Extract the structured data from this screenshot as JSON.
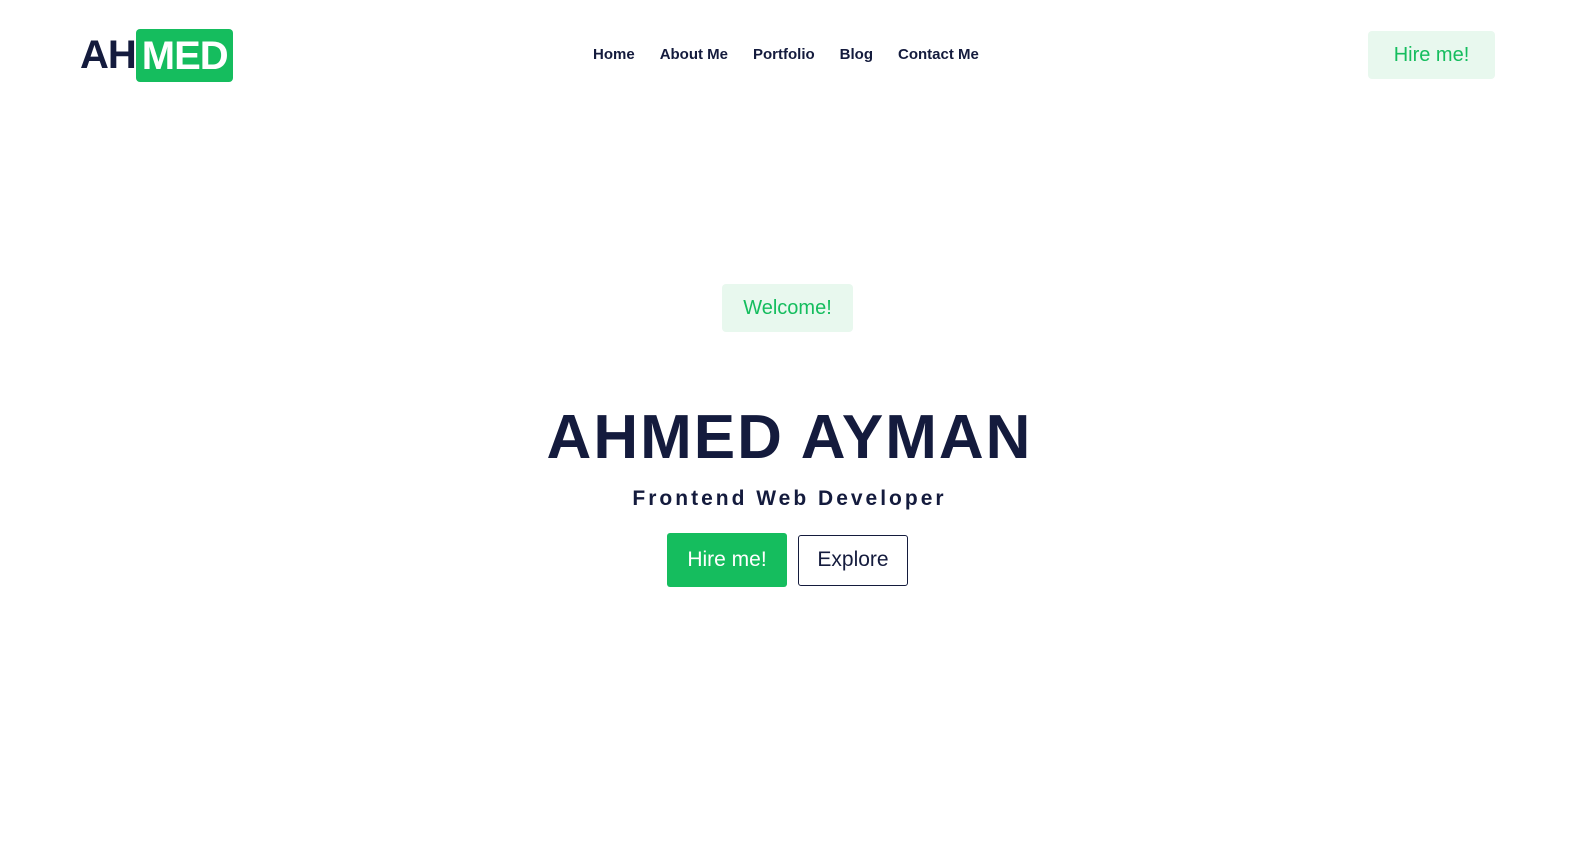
{
  "header": {
    "logo": {
      "part_a": "AH",
      "part_b": "MED"
    },
    "nav": [
      {
        "label": "Home"
      },
      {
        "label": "About Me"
      },
      {
        "label": "Portfolio"
      },
      {
        "label": "Blog"
      },
      {
        "label": "Contact Me"
      }
    ],
    "cta_label": "Hire me!"
  },
  "hero": {
    "badge": "Welcome!",
    "name": "AHMED AYMAN",
    "role": "Frontend Web Developer",
    "primary_button": "Hire me!",
    "secondary_button": "Explore"
  },
  "colors": {
    "accent": "#15bd5e",
    "accent_light": "#e8f8ee",
    "text_dark": "#141b3d",
    "background": "#ffffff"
  }
}
